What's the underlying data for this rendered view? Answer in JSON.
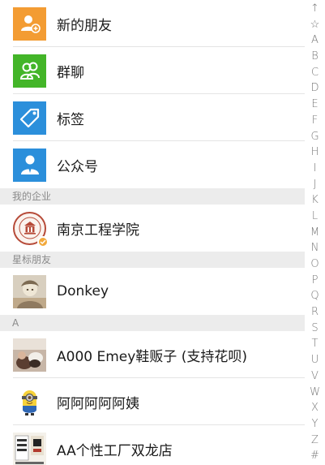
{
  "functions": [
    {
      "label": "新的朋友",
      "icon": "add-friend-icon",
      "color": "#f39c33"
    },
    {
      "label": "群聊",
      "icon": "group-chat-icon",
      "color": "#43b528"
    },
    {
      "label": "标签",
      "icon": "tag-icon",
      "color": "#2b8fdb"
    },
    {
      "label": "公众号",
      "icon": "official-account-icon",
      "color": "#2b8fdb"
    }
  ],
  "sections": {
    "enterprise": "我的企业",
    "starred": "星标朋友",
    "a": "A"
  },
  "enterprise": {
    "label": "南京工程学院",
    "badge_color": "#f2a93b"
  },
  "starred": [
    {
      "label": "Donkey"
    }
  ],
  "contacts_a": [
    {
      "label": "A000   Emey鞋贩子 (支持花呗)"
    },
    {
      "label": "阿阿阿阿阿姨"
    },
    {
      "label": "AA个性工厂双龙店"
    }
  ],
  "index": [
    "↑",
    "☆",
    "A",
    "B",
    "C",
    "D",
    "E",
    "F",
    "G",
    "H",
    "I",
    "J",
    "K",
    "L",
    "M",
    "N",
    "O",
    "P",
    "Q",
    "R",
    "S",
    "T",
    "U",
    "V",
    "W",
    "X",
    "Y",
    "Z",
    "#"
  ]
}
